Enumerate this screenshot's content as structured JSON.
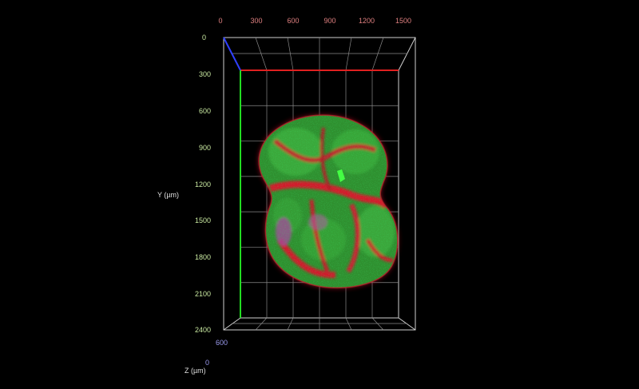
{
  "view": {
    "background": "#000000",
    "box_color": "#d8d8d8",
    "colors": {
      "x_axis": "#e02020",
      "y_axis": "#22dd22",
      "z_axis": "#3040ff",
      "x_tick_text": "#e08080",
      "y_tick_text": "#c8e8a0",
      "z_tick_text": "#9a9aee",
      "stain_green": "#2a9a2a",
      "stain_red": "#d01830",
      "stain_magenta": "#b04090"
    }
  },
  "axes": {
    "x": {
      "ticks": [
        "0",
        "300",
        "600",
        "900",
        "1200",
        "1500"
      ]
    },
    "y": {
      "label": "Y (µm)",
      "ticks": [
        "0",
        "300",
        "600",
        "900",
        "1200",
        "1500",
        "1800",
        "2100",
        "2400"
      ]
    },
    "z": {
      "label": "Z (µm)",
      "ticks": [
        "600",
        "0"
      ]
    }
  },
  "specimen": {
    "icon": "3d-volume-rendering"
  }
}
